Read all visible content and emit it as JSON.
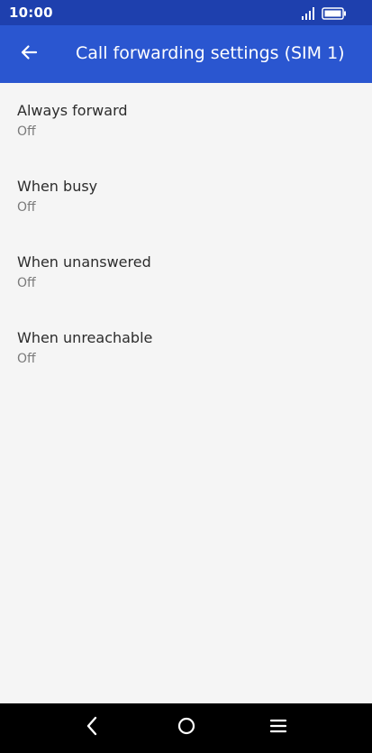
{
  "status_bar": {
    "time": "10:00",
    "signal_icon": "signal-icon",
    "battery_icon": "battery-icon"
  },
  "app_bar": {
    "back_icon": "arrow-back-icon",
    "title": "Call forwarding settings (SIM 1)",
    "color": "#2a56d0",
    "status_color": "#1e40ae"
  },
  "settings": [
    {
      "title": "Always forward",
      "summary": "Off"
    },
    {
      "title": "When busy",
      "summary": "Off"
    },
    {
      "title": "When unanswered",
      "summary": "Off"
    },
    {
      "title": "When unreachable",
      "summary": "Off"
    }
  ],
  "nav_bar": {
    "back_icon": "nav-back-icon",
    "home_icon": "nav-home-icon",
    "menu_icon": "nav-menu-icon"
  }
}
